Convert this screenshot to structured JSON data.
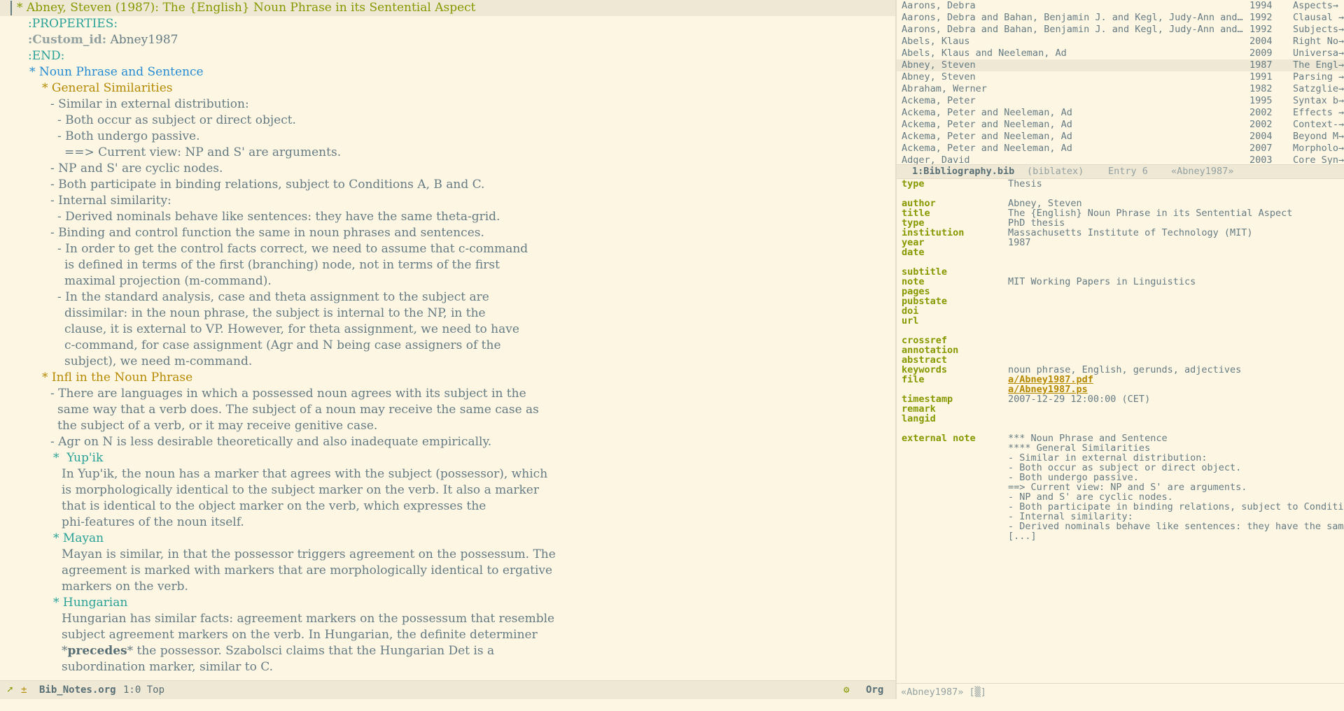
{
  "org": {
    "lines": [
      {
        "text": "* Abney, Steven (1987): The {English} Noun Phrase in its Sentential Aspect",
        "cls": "c-h1",
        "indent": 24
      },
      {
        "text": ":PROPERTIES:",
        "cls": "c-prop",
        "indent": 40
      },
      {
        "key": ":Custom_id:",
        "text": " Abney1987",
        "cls": "c-body",
        "indent": 40
      },
      {
        "text": ":END:",
        "cls": "c-prop",
        "indent": 40
      },
      {
        "text": "* Noun Phrase and Sentence",
        "cls": "c-h2",
        "indent": 42
      },
      {
        "text": "* General Similarities",
        "cls": "c-h3",
        "indent": 60
      },
      {
        "text": "- Similar in external distribution:",
        "cls": "c-body",
        "indent": 72
      },
      {
        "text": "- Both occur as subject or direct object.",
        "cls": "c-body",
        "indent": 82
      },
      {
        "text": "- Both undergo passive.",
        "cls": "c-body",
        "indent": 82
      },
      {
        "text": "==> Current view: NP and S' are arguments.",
        "cls": "c-body",
        "indent": 92
      },
      {
        "text": "- NP and S' are cyclic nodes.",
        "cls": "c-body",
        "indent": 72
      },
      {
        "text": "- Both participate in binding relations, subject to Conditions A, B and C.",
        "cls": "c-body",
        "indent": 72
      },
      {
        "text": "- Internal similarity:",
        "cls": "c-body",
        "indent": 72
      },
      {
        "text": "- Derived nominals behave like sentences: they have the same theta-grid.",
        "cls": "c-body",
        "indent": 82
      },
      {
        "text": "- Binding and control function the same in noun phrases and sentences.",
        "cls": "c-body",
        "indent": 72
      },
      {
        "text": "- In order to get the control facts correct, we need to assume that c-command",
        "cls": "c-body",
        "indent": 82
      },
      {
        "text": "is defined in terms of the first (branching) node, not in terms of the first",
        "cls": "c-body",
        "indent": 92
      },
      {
        "text": "maximal projection (m-command).",
        "cls": "c-body",
        "indent": 92
      },
      {
        "text": "- In the standard analysis, case and theta assignment to the subject are",
        "cls": "c-body",
        "indent": 82
      },
      {
        "text": "dissimilar: in the noun phrase, the subject is internal to the NP, in the",
        "cls": "c-body",
        "indent": 92
      },
      {
        "text": "clause, it is external to VP. However, for theta assignment, we need to have",
        "cls": "c-body",
        "indent": 92
      },
      {
        "text": "c-command, for case assignment (Agr and N being case assigners of the",
        "cls": "c-body",
        "indent": 92
      },
      {
        "text": "subject), we need m-command.",
        "cls": "c-body",
        "indent": 92
      },
      {
        "text": "* Infl in the Noun Phrase",
        "cls": "c-h3",
        "indent": 60
      },
      {
        "text": "- There are languages in which a possessed noun agrees with its subject in the",
        "cls": "c-body",
        "indent": 72
      },
      {
        "text": "same way that a verb does. The subject of a noun may receive the same case as",
        "cls": "c-body",
        "indent": 82
      },
      {
        "text": "the subject of a verb, or it may receive genitive case.",
        "cls": "c-body",
        "indent": 82
      },
      {
        "text": "- Agr on N is less desirable theoretically and also inadequate empirically.",
        "cls": "c-body",
        "indent": 72
      },
      {
        "text": "*  Yup'ik",
        "cls": "c-h4",
        "indent": 76
      },
      {
        "text": "In Yup'ik, the noun has a marker that agrees with the subject (possessor), which",
        "cls": "c-body",
        "indent": 88
      },
      {
        "text": "is morphologically identical to the subject marker on the verb. It also a marker",
        "cls": "c-body",
        "indent": 88
      },
      {
        "text": "that is identical to the object marker on the verb, which expresses the",
        "cls": "c-body",
        "indent": 88
      },
      {
        "text": "phi-features of the noun itself.",
        "cls": "c-body",
        "indent": 88
      },
      {
        "text": "* Mayan",
        "cls": "c-h4",
        "indent": 76
      },
      {
        "text": "Mayan is similar, in that the possessor triggers agreement on the possessum. The",
        "cls": "c-body",
        "indent": 88
      },
      {
        "text": "agreement is marked with markers that are morphologically identical to ergative",
        "cls": "c-body",
        "indent": 88
      },
      {
        "text": "markers on the verb.",
        "cls": "c-body",
        "indent": 88
      },
      {
        "text": "* Hungarian",
        "cls": "c-h4",
        "indent": 76
      },
      {
        "text": "Hungarian has similar facts: agreement markers on the possessum that resemble",
        "cls": "c-body",
        "indent": 88
      },
      {
        "text": "subject agreement markers on the verb. In Hungarian, the definite determiner",
        "cls": "c-body",
        "indent": 88
      },
      {
        "pre": "*",
        "boldtext": "precedes",
        "post": "* the possessor. Szabolsci claims that the Hungarian Det is a",
        "cls": "c-body",
        "indent": 88
      },
      {
        "text": "subordination marker, similar to C.",
        "cls": "c-body",
        "indent": 88
      }
    ]
  },
  "left_modeline": {
    "file": "Bib_Notes.org",
    "position": "1:0 Top",
    "mode": "Org"
  },
  "bib_list": [
    {
      "author": "Aarons, Debra",
      "year": "1994",
      "title": "Aspects→"
    },
    {
      "author": "Aarons, Debra and Bahan, Benjamin J. and Kegl, Judy-Ann and…",
      "year": "1992",
      "title": "Clausal →"
    },
    {
      "author": "Aarons, Debra and Bahan, Benjamin J. and Kegl, Judy-Ann and…",
      "year": "1992",
      "title": "Subjects→"
    },
    {
      "author": "Abels, Klaus",
      "year": "2004",
      "title": "Right No→"
    },
    {
      "author": "Abels, Klaus and Neeleman, Ad",
      "year": "2009",
      "title": "Universa→"
    },
    {
      "author": "Abney, Steven",
      "year": "1987",
      "title": "The Engl→",
      "selected": true
    },
    {
      "author": "Abney, Steven",
      "year": "1991",
      "title": "Parsing →"
    },
    {
      "author": "Abraham, Werner",
      "year": "1982",
      "title": "Satzglie→"
    },
    {
      "author": "Ackema, Peter",
      "year": "1995",
      "title": "Syntax b→"
    },
    {
      "author": "Ackema, Peter and Neeleman, Ad",
      "year": "2002",
      "title": "Effects →"
    },
    {
      "author": "Ackema, Peter and Neeleman, Ad",
      "year": "2002",
      "title": "Context-→"
    },
    {
      "author": "Ackema, Peter and Neeleman, Ad",
      "year": "2004",
      "title": "Beyond M→"
    },
    {
      "author": "Ackema, Peter and Neeleman, Ad",
      "year": "2007",
      "title": "Morpholo→"
    },
    {
      "author": "Adger, David",
      "year": "2003",
      "title": "Core Syn→"
    }
  ],
  "mid_modeline": {
    "buffer": "1:Bibliography.bib",
    "mode": "(biblatex)",
    "entry": "Entry 6",
    "key": "«Abney1987»"
  },
  "entry_fields": [
    {
      "name": "type",
      "value": "Thesis"
    },
    {
      "name": "",
      "value": ""
    },
    {
      "name": "author",
      "value": "Abney, Steven"
    },
    {
      "name": "title",
      "value": "The {English} Noun Phrase in its Sentential Aspect"
    },
    {
      "name": "type",
      "value": "PhD thesis"
    },
    {
      "name": "institution",
      "value": "Massachusetts Institute of Technology (MIT)"
    },
    {
      "name": "year",
      "value": "1987"
    },
    {
      "name": "date",
      "value": ""
    },
    {
      "name": "",
      "value": ""
    },
    {
      "name": "subtitle",
      "value": ""
    },
    {
      "name": "note",
      "value": "MIT Working Papers in Linguistics"
    },
    {
      "name": "pages",
      "value": ""
    },
    {
      "name": "pubstate",
      "value": ""
    },
    {
      "name": "doi",
      "value": ""
    },
    {
      "name": "url",
      "value": ""
    },
    {
      "name": "",
      "value": ""
    },
    {
      "name": "crossref",
      "value": ""
    },
    {
      "name": "annotation",
      "value": ""
    },
    {
      "name": "abstract",
      "value": ""
    },
    {
      "name": "keywords",
      "value": "noun phrase, English, gerunds, adjectives"
    },
    {
      "name": "file",
      "value": "a/Abney1987.pdf",
      "link": true
    },
    {
      "name": "",
      "value": "a/Abney1987.ps",
      "link": true
    },
    {
      "name": "timestamp",
      "value": "2007-12-29 12:00:00 (CET)"
    },
    {
      "name": "remark",
      "value": ""
    },
    {
      "name": "langid",
      "value": ""
    },
    {
      "name": "",
      "value": ""
    },
    {
      "name": "external note",
      "value": "*** Noun Phrase and Sentence"
    }
  ],
  "external_note_lines": [
    "**** General Similarities",
    "- Similar in external distribution:",
    "- Both occur as subject or direct object.",
    "- Both undergo passive.",
    "==> Current view: NP and S' are arguments.",
    "- NP and S' are cyclic nodes.",
    "- Both participate in binding relations, subject to Conditi→",
    "- Internal similarity:",
    "- Derived nominals behave like sentences: they have the sam→",
    "[...]"
  ],
  "right_modeline": {
    "text": "«Abney1987» [▒]"
  },
  "colors": {
    "background": "#fdf6e3",
    "highlight": "#eee8d5",
    "heading1": "#859900",
    "heading2": "#268bd2",
    "heading3": "#b58900",
    "heading4": "#2aa198",
    "field_name": "#859900",
    "link": "#b58900"
  }
}
